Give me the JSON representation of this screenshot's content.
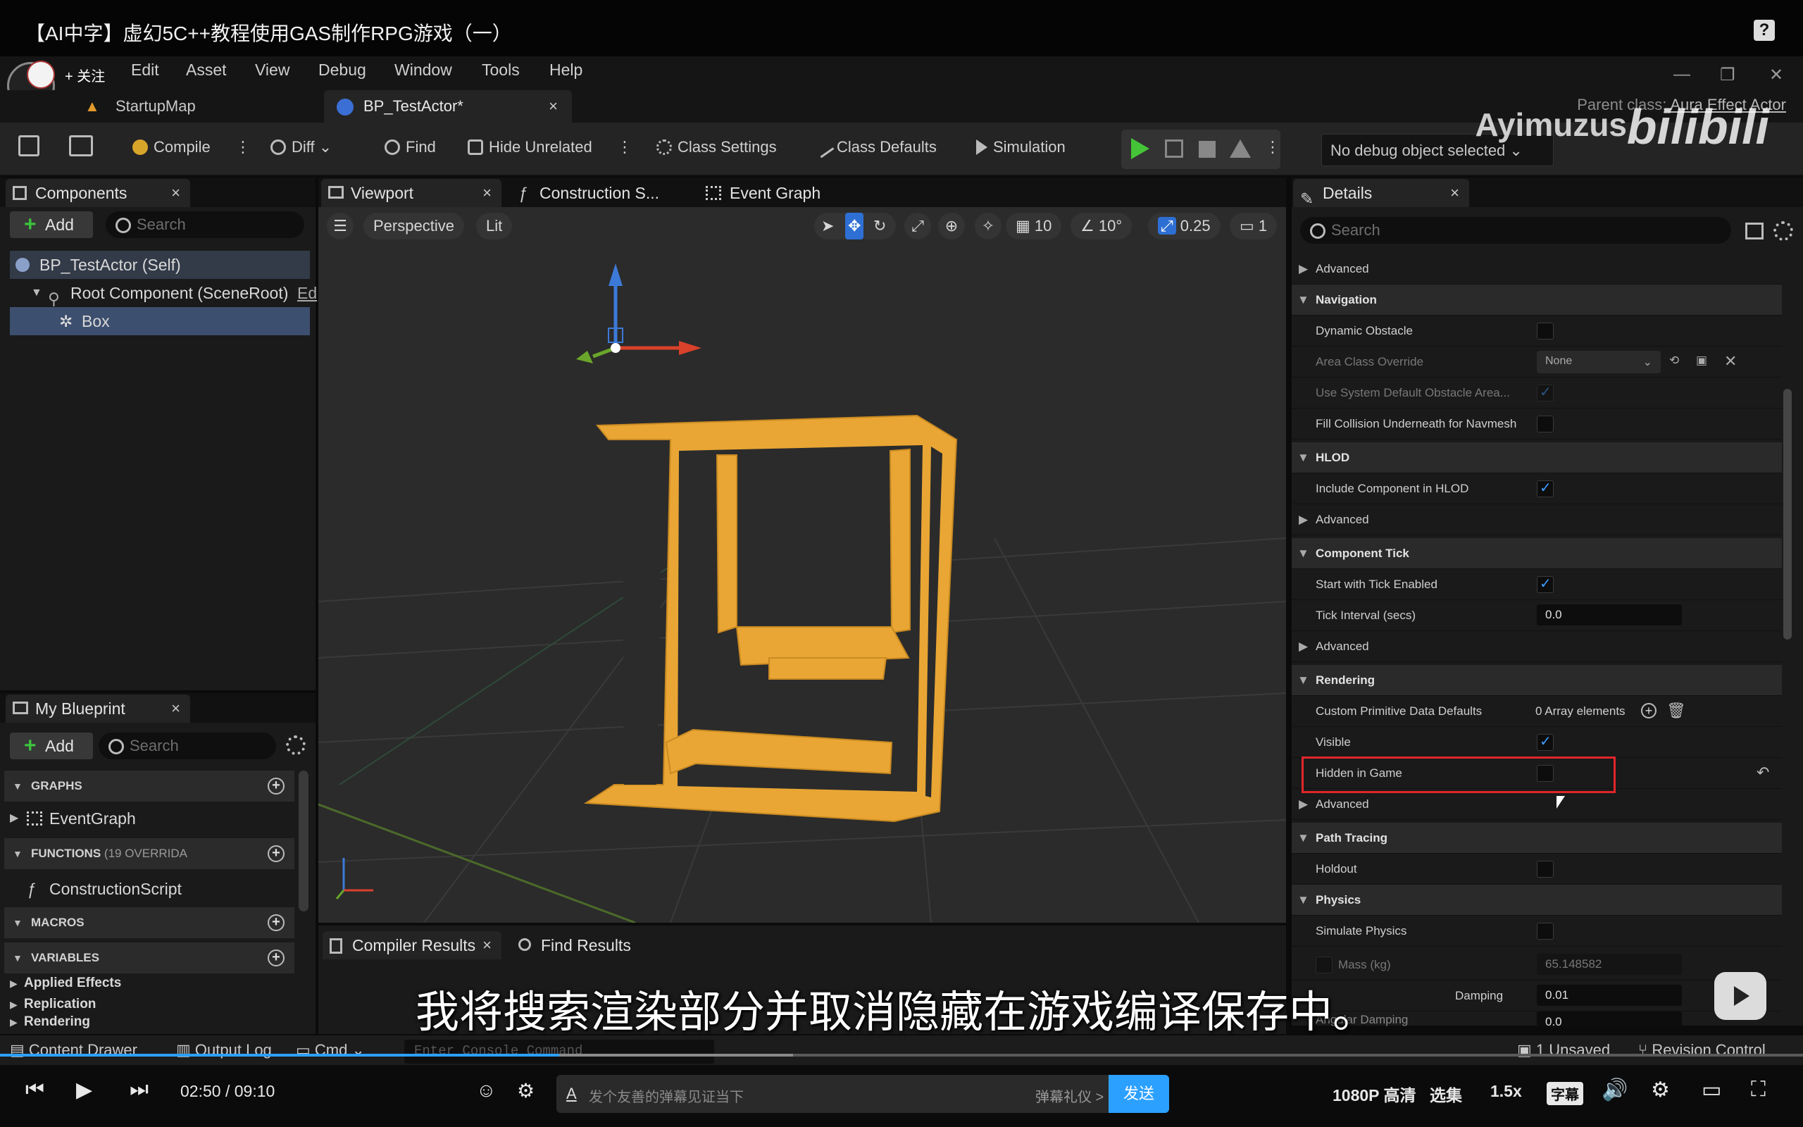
{
  "video": {
    "title": "【AI中字】虚幻5C++教程使用GAS制作RPG游戏（一）",
    "help_icon": "?"
  },
  "menu": {
    "follow": "+ 关注",
    "items": [
      "Edit",
      "Asset",
      "View",
      "Debug",
      "Window",
      "Tools",
      "Help"
    ],
    "window_controls": [
      "—",
      "❐",
      "✕"
    ]
  },
  "doc_tabs": {
    "startup": "StartupMap",
    "blueprint": "BP_TestActor*",
    "close": "×",
    "parent_class_label": "Parent class:",
    "parent_class_value": "Aura Effect Actor"
  },
  "toolbar": {
    "compile": "Compile",
    "diff": "Diff",
    "find": "Find",
    "hide_unrelated": "Hide Unrelated",
    "class_settings": "Class Settings",
    "class_defaults": "Class Defaults",
    "simulation": "Simulation",
    "debug_object": "No debug object selected"
  },
  "watermark": {
    "channel": "Ayimuzus",
    "logo": "bilibili"
  },
  "components": {
    "tab": "Components",
    "add": "Add",
    "search_placeholder": "Search",
    "rows": [
      "BP_TestActor (Self)",
      "Root Component (SceneRoot)",
      "Box"
    ],
    "root_suffix": "Ed"
  },
  "my_blueprint": {
    "tab": "My Blueprint",
    "add": "Add",
    "search_placeholder": "Search",
    "graphs": "GRAPHS",
    "event_graph": "EventGraph",
    "functions": "FUNCTIONS",
    "functions_count": "(19 OVERRIDA",
    "construction_script": "ConstructionScript",
    "macros": "MACROS",
    "variables": "VARIABLES",
    "var_items": [
      "Applied Effects",
      "Replication",
      "Rendering"
    ]
  },
  "editor_tabs": {
    "viewport": "Viewport",
    "construction": "Construction S...",
    "event_graph": "Event Graph"
  },
  "viewport": {
    "perspective": "Perspective",
    "lit": "Lit",
    "grid": "10",
    "angle": "10°",
    "scale": "0.25",
    "camera": "1",
    "colors": {
      "box": "#e9a634",
      "x_axis": "#d9412b",
      "y_axis": "#6aa62b",
      "z_axis": "#3d7ad8"
    }
  },
  "compiler": {
    "results": "Compiler Results",
    "find_results": "Find Results"
  },
  "details": {
    "tab": "Details",
    "search_placeholder": "Search",
    "advanced": "Advanced",
    "navigation": "Navigation",
    "dynamic_obstacle": "Dynamic Obstacle",
    "area_class_override": "Area Class Override",
    "area_class_value": "None",
    "use_system_default": "Use System Default Obstacle Area...",
    "fill_collision": "Fill Collision Underneath for Navmesh",
    "hlod": "HLOD",
    "include_hlod": "Include Component in HLOD",
    "component_tick": "Component Tick",
    "start_tick": "Start with Tick Enabled",
    "tick_interval": "Tick Interval (secs)",
    "tick_interval_value": "0.0",
    "rendering": "Rendering",
    "custom_primitive": "Custom Primitive Data Defaults",
    "array_elements": "0 Array elements",
    "visible": "Visible",
    "hidden_in_game": "Hidden in Game",
    "path_tracing": "Path Tracing",
    "holdout": "Holdout",
    "physics": "Physics",
    "simulate_physics": "Simulate Physics",
    "mass": "Mass (kg)",
    "mass_value": "65.148582",
    "damping": "Damping",
    "damping_value": "0.01",
    "angular_damping": "Angular Damping",
    "angular_value": "0.0",
    "highlight_color": "#e0262b"
  },
  "subtitle": "我将搜索渲染部分并取消隐藏在游戏编译保存中。",
  "bottom": {
    "content_drawer": "Content Drawer",
    "output_log": "Output Log",
    "cmd": "Cmd",
    "console_placeholder": "Enter Console Command",
    "unsaved": "1 Unsaved",
    "revision_control": "Revision Control"
  },
  "player": {
    "time_current": "02:50",
    "time_sep": "/",
    "time_total": "09:10",
    "progress": 0.31,
    "buffered": 0.44,
    "danmaku_placeholder": "发个友善的弹幕见证当下",
    "danmaku_etiquette": "弹幕礼仪 >",
    "send": "发送",
    "quality": "1080P 高清",
    "episodes": "选集",
    "speed": "1.5x",
    "subtitle_btn": "字幕"
  }
}
